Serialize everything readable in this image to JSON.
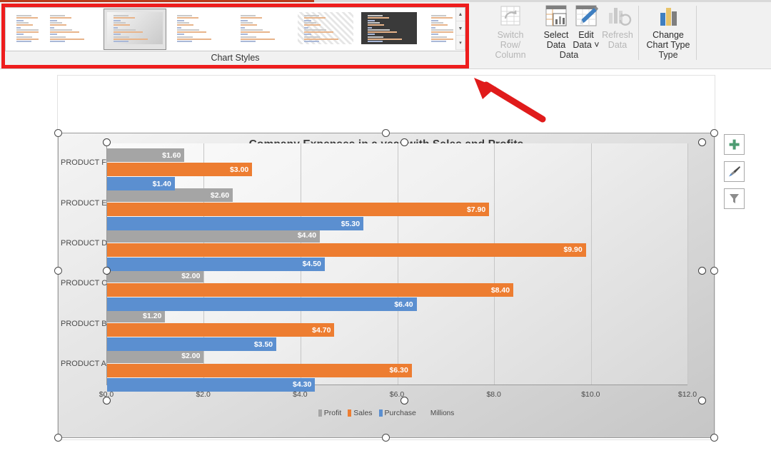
{
  "ribbon": {
    "chart_styles_group_label": "Chart Styles",
    "data_group_label": "Data",
    "type_group_label": "Type",
    "commands": {
      "switch_row_column": "Switch Row/\nColumn",
      "switch_row_column_line1": "Switch Row/",
      "switch_row_column_line2": "Column",
      "select_data_line1": "Select",
      "select_data_line2": "Data",
      "edit_data_line1": "Edit",
      "edit_data_line2": "Data ˅",
      "refresh_data_line1": "Refresh",
      "refresh_data_line2": "Data",
      "change_chart_type_line1": "Change",
      "change_chart_type_line2": "Chart Type"
    },
    "gallery_scroll": {
      "up": "▲",
      "down": "▼",
      "more": "▾"
    }
  },
  "chart_buttons": {
    "elements": "+",
    "styles": "✎",
    "filters": "∇"
  },
  "chart_data": {
    "type": "bar",
    "orientation": "horizontal",
    "title": "Company Expenses in a year with Sales and Profits",
    "xlabel": "",
    "ylabel": "",
    "units_label": "Millions",
    "xlim": [
      0,
      12
    ],
    "xticks": [
      0,
      2,
      4,
      6,
      8,
      10,
      12
    ],
    "xtick_labels": [
      "$0.0",
      "$2.0",
      "$4.0",
      "$6.0",
      "$8.0",
      "$10.0",
      "$12.0"
    ],
    "grid": true,
    "legend_position": "bottom",
    "categories": [
      "PRODUCT A",
      "PRODUCT B",
      "PRODUCT C",
      "PRODUCT D",
      "PRODUCT E",
      "PRODUCT F"
    ],
    "series": [
      {
        "name": "Purchase",
        "color": "#5b8fd0",
        "values": [
          4.3,
          3.5,
          6.4,
          4.5,
          5.3,
          1.4
        ],
        "labels": [
          "$4.30",
          "$3.50",
          "$6.40",
          "$4.50",
          "$5.30",
          "$1.40"
        ]
      },
      {
        "name": "Sales",
        "color": "#ed7d31",
        "values": [
          6.3,
          4.7,
          8.4,
          9.9,
          7.9,
          3.0
        ],
        "labels": [
          "$6.30",
          "$4.70",
          "$8.40",
          "$9.90",
          "$7.90",
          "$3.00"
        ]
      },
      {
        "name": "Profit",
        "color": "#a5a5a5",
        "values": [
          2.0,
          1.2,
          2.0,
          4.4,
          2.6,
          1.6
        ],
        "labels": [
          "$2.00",
          "$1.20",
          "$2.00",
          "$4.40",
          "$2.60",
          "$1.60"
        ]
      }
    ],
    "legend": [
      {
        "label": "Profit",
        "color": "#a5a5a5"
      },
      {
        "label": "Sales",
        "color": "#ed7d31"
      },
      {
        "label": "Purchase",
        "color": "#5b8fd0"
      }
    ]
  },
  "annotation": {
    "arrow_color": "#e01b1b",
    "highlight_color": "#ee1d1d"
  },
  "gallery_thumbnails": [
    {
      "variant": "plain",
      "selected": false,
      "partial": true
    },
    {
      "variant": "plain",
      "selected": false,
      "partial": false
    },
    {
      "variant": "grad",
      "selected": true,
      "partial": false
    },
    {
      "variant": "plain",
      "selected": false,
      "partial": false
    },
    {
      "variant": "plain",
      "selected": false,
      "partial": false
    },
    {
      "variant": "hatch",
      "selected": false,
      "partial": false
    },
    {
      "variant": "dark",
      "selected": false,
      "partial": false
    },
    {
      "variant": "plain",
      "selected": false,
      "partial": true
    }
  ]
}
